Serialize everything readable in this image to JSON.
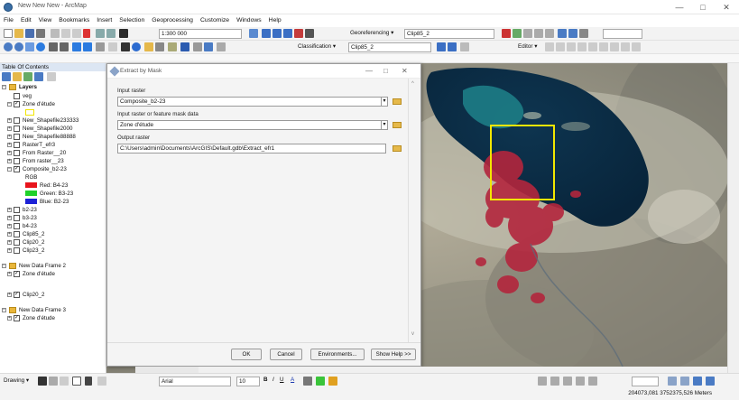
{
  "window": {
    "title": "New New New - ArcMap",
    "controls": [
      "—",
      "□",
      "✕"
    ]
  },
  "menu": [
    "File",
    "Edit",
    "View",
    "Bookmarks",
    "Insert",
    "Selection",
    "Geoprocessing",
    "Customize",
    "Windows",
    "Help"
  ],
  "toolbar": {
    "scale": "1:300 000",
    "georeferencing_label": "Georeferencing ▾",
    "georef_layer": "Clip85_2",
    "classification_label": "Classification ▾",
    "classification_layer": "Clip85_2",
    "editor_label": "Editor ▾"
  },
  "toc": {
    "title": "Table Of Contents",
    "layers_frame": "Layers",
    "items": [
      {
        "label": "veg",
        "checked": false,
        "expander": ""
      },
      {
        "label": "Zone d'étude",
        "checked": true,
        "expander": "−"
      },
      {
        "label": "New_Shapefile233333",
        "checked": false,
        "expander": "+"
      },
      {
        "label": "New_Shapefile2000",
        "checked": false,
        "expander": "+"
      },
      {
        "label": "New_Shapefile88888",
        "checked": false,
        "expander": "+"
      },
      {
        "label": "RasterT_efr3",
        "checked": false,
        "expander": "+"
      },
      {
        "label": "From Raster__20",
        "checked": false,
        "expander": "+"
      },
      {
        "label": "From raster__23",
        "checked": false,
        "expander": "+"
      },
      {
        "label": "Composite_b2-23",
        "checked": true,
        "expander": "−"
      }
    ],
    "rgb_label": "RGB",
    "bands": [
      {
        "label": "Red:  B4-23",
        "color": "#e8141c"
      },
      {
        "label": "Green: B3-23",
        "color": "#1fd12a"
      },
      {
        "label": "Blue:  B2-23",
        "color": "#1d22d6"
      }
    ],
    "items2": [
      {
        "label": "b2-23",
        "checked": false
      },
      {
        "label": "b3-23",
        "checked": false
      },
      {
        "label": "b4-23",
        "checked": false
      },
      {
        "label": "Clip85_2",
        "checked": false
      },
      {
        "label": "Clip20_2",
        "checked": false
      },
      {
        "label": "Clip23_2",
        "checked": false
      }
    ],
    "frame2": "New Data Frame 2",
    "frame2_items": [
      {
        "label": "Zone d'étude",
        "checked": true
      },
      {
        "label": "Clip20_2",
        "checked": true
      }
    ],
    "frame3": "New Data Frame 3",
    "frame3_items": [
      {
        "label": "Zone d'étude",
        "checked": true
      }
    ]
  },
  "dialog": {
    "title": "Extract by Mask",
    "input_raster_label": "Input raster",
    "input_raster_value": "Composite_b2-23",
    "mask_label": "Input raster or feature mask data",
    "mask_value": "Zone d'étude",
    "output_label": "Output raster",
    "output_value": "C:\\Users\\admin\\Documents\\ArcGIS\\Default.gdb\\Extract_efr1",
    "buttons": {
      "ok": "OK",
      "cancel": "Cancel",
      "environments": "Environments...",
      "show_help": "Show Help >>"
    }
  },
  "drawing": {
    "label": "Drawing ▾",
    "font": "Arial",
    "size": "10"
  },
  "status": {
    "coordinates": "204073,081  3752375,526 Meters"
  },
  "colors": {
    "lake": "#0d2c44",
    "vegetation": "#b3263d",
    "aoi_box": "#f2e600",
    "toc_header": "#dce6f3"
  }
}
